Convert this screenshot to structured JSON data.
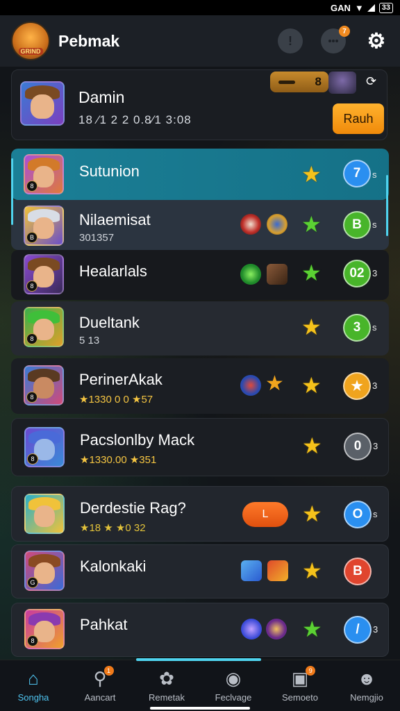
{
  "status_bar": {
    "carrier": "GAN",
    "battery": "33"
  },
  "header": {
    "title": "Pebmak",
    "logo_text": "GRIND",
    "alert_icon_text": "!",
    "chat_badge": "7",
    "icons": [
      "alert-icon",
      "chat-icon",
      "gear-icon"
    ]
  },
  "profile": {
    "name": "Damin",
    "stats": "18 ⁄1 2 2 0.8⁄1 3:08",
    "pill_value": "8",
    "action_label": "Rauh"
  },
  "rows": [
    {
      "name": "Sutunion",
      "sub": "",
      "circle": "7",
      "suffix": "s",
      "star": "gold",
      "circle_color": "#2a8ff0"
    },
    {
      "name": "Nilaemisat",
      "sub": "301357",
      "circle": "B",
      "suffix": "s",
      "star": "green",
      "circle_color": "#48b52a"
    },
    {
      "name": "Healarlals",
      "sub": "",
      "circle": "02",
      "suffix": "3",
      "star": "green",
      "circle_color": "#48b52a"
    },
    {
      "name": "Dueltank",
      "sub": "5 13",
      "circle": "3",
      "suffix": "s",
      "star": "gold",
      "circle_color": "#48b52a"
    },
    {
      "name": "PerinerAkak",
      "sub": "★1330 0 0 ★57",
      "circle": "★",
      "suffix": "3",
      "star": "gold",
      "circle_color": "#f0a41e"
    },
    {
      "name": "Pacslonlby Mack",
      "sub": "★1330.00 ★351",
      "circle": "0",
      "suffix": "3",
      "star": "gold",
      "circle_color": "#5a6068"
    },
    {
      "name": "Derdestie Rag?",
      "sub": "★18 ★ ★0 32",
      "circle": "O",
      "suffix": "s",
      "star": "gold",
      "circle_color": "#2a8ff0",
      "pill": "L"
    },
    {
      "name": "Kalonkaki",
      "sub": "",
      "circle": "B",
      "suffix": "",
      "star": "gold",
      "circle_color": "#e0452e"
    },
    {
      "name": "Pahkat",
      "sub": "",
      "circle": "/",
      "suffix": "3",
      "star": "green",
      "circle_color": "#2a8ff0"
    }
  ],
  "bottom_nav": [
    {
      "label": "Songha",
      "icon": "home-icon",
      "active": true
    },
    {
      "label": "Aancart",
      "icon": "search-icon",
      "badge": "1"
    },
    {
      "label": "Remetak",
      "icon": "puzzle-icon"
    },
    {
      "label": "Feclvage",
      "icon": "camera-icon"
    },
    {
      "label": "Semoeto",
      "icon": "bag-icon",
      "badge": "9"
    },
    {
      "label": "Nemgjio",
      "icon": "profile-icon"
    }
  ]
}
